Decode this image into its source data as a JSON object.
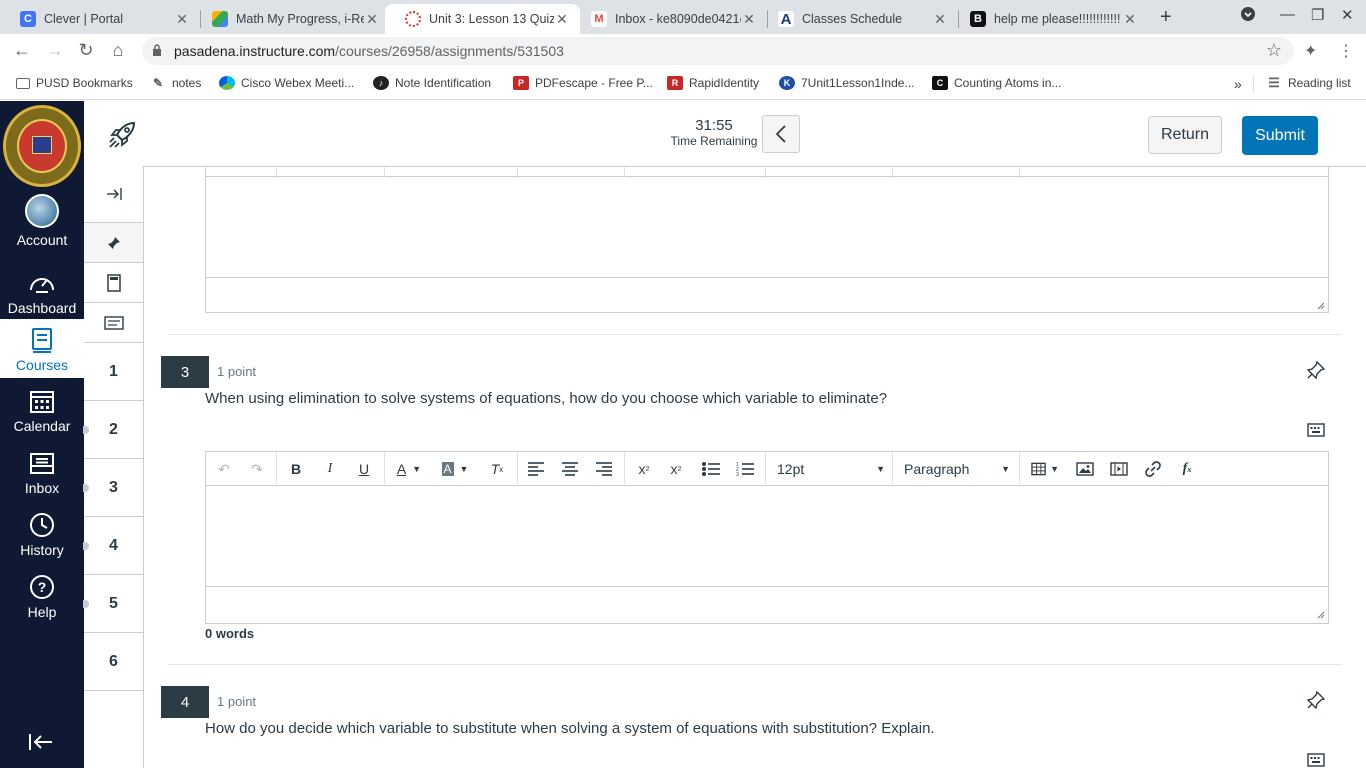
{
  "browser": {
    "tabs": [
      {
        "title": "Clever | Portal",
        "favicon_letter": "C",
        "favicon_color": "#4274f6"
      },
      {
        "title": "Math My Progress, i-Re",
        "favicon_letter": "",
        "favicon_color": "#5cb85c"
      },
      {
        "title": "Unit 3: Lesson 13 Quiz",
        "favicon_letter": "",
        "favicon_color": "#d93025"
      },
      {
        "title": "Inbox - ke8090de0421@",
        "favicon_letter": "M",
        "favicon_color": "#ea4335"
      },
      {
        "title": "Classes Schedule",
        "favicon_letter": "A",
        "favicon_color": "#1a3a8a"
      },
      {
        "title": "help me please!!!!!!!!!!!!",
        "favicon_letter": "B",
        "favicon_color": "#111111"
      }
    ],
    "url_host": "pasadena.instructure.com",
    "url_path": "/courses/26958/assignments/531503",
    "bookmarks": [
      {
        "label": "PUSD Bookmarks",
        "icon": "folder-icon"
      },
      {
        "label": "notes",
        "icon": "notes-icon"
      },
      {
        "label": "Cisco Webex Meeti...",
        "icon": "webex-icon"
      },
      {
        "label": "Note Identification",
        "icon": "music-icon"
      },
      {
        "label": "PDFescape - Free P...",
        "icon": "pdf-icon"
      },
      {
        "label": "RapidIdentity",
        "icon": "rapid-icon"
      },
      {
        "label": "7Unit1Lesson1Inde...",
        "icon": "k-icon"
      },
      {
        "label": "Counting Atoms in...",
        "icon": "cs-icon"
      }
    ],
    "reading_list": "Reading list",
    "overflow": "»"
  },
  "global_nav": {
    "items": [
      {
        "label": "Account",
        "icon": "avatar"
      },
      {
        "label": "Dashboard",
        "icon": "dashboard-icon"
      },
      {
        "label": "Courses",
        "icon": "courses-icon"
      },
      {
        "label": "Calendar",
        "icon": "calendar-icon"
      },
      {
        "label": "Inbox",
        "icon": "inbox-icon"
      },
      {
        "label": "History",
        "icon": "history-icon"
      },
      {
        "label": "Help",
        "icon": "help-icon"
      }
    ],
    "active": "Courses"
  },
  "header": {
    "timer_value": "31:55",
    "timer_label": "Time Remaining",
    "return_label": "Return",
    "submit_label": "Submit"
  },
  "question_nav": {
    "numbers": [
      "1",
      "2",
      "3",
      "4",
      "5",
      "6"
    ]
  },
  "editor_toolbar": {
    "font_size": "12pt",
    "block_format": "Paragraph"
  },
  "questions": [
    {
      "number": "3",
      "points": "1 point",
      "text": "When using elimination to solve systems of equations, how do you choose which variable to eliminate?",
      "word_count": "0 words"
    },
    {
      "number": "4",
      "points": "1 point",
      "text": "How do you decide which variable to substitute when solving a system of equations with substitution? Explain."
    }
  ],
  "colors": {
    "nav_bg": "#0f1934",
    "accent": "#0374b5",
    "question_badge": "#2d3b45"
  }
}
